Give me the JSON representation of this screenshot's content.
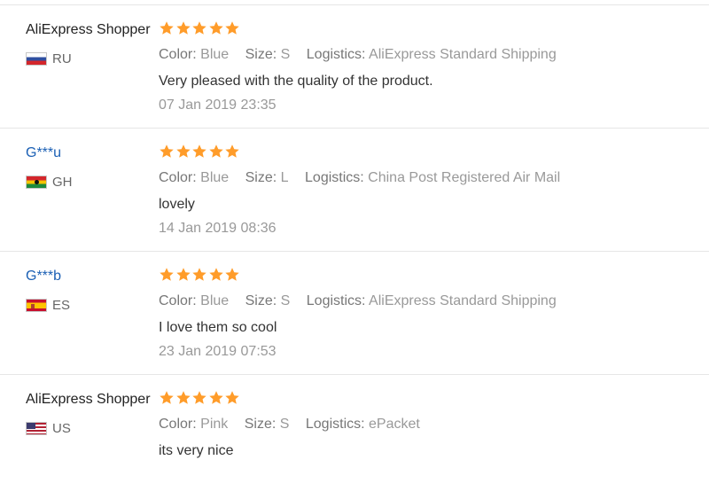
{
  "reviews": [
    {
      "user": "AliExpress Shopper",
      "country": "RU",
      "rating": 5,
      "attributes": [
        {
          "key": "Color:",
          "value": "Blue"
        },
        {
          "key": "Size:",
          "value": "S"
        },
        {
          "key": "Logistics:",
          "value": "AliExpress Standard Shipping"
        }
      ],
      "text": "Very pleased with the quality of the product.",
      "date": "07 Jan 2019 23:35"
    },
    {
      "user": "G***u",
      "country": "GH",
      "rating": 5,
      "attributes": [
        {
          "key": "Color:",
          "value": "Blue"
        },
        {
          "key": "Size:",
          "value": "L"
        },
        {
          "key": "Logistics:",
          "value": "China Post Registered Air Mail"
        }
      ],
      "text": "lovely",
      "date": "14 Jan 2019 08:36"
    },
    {
      "user": "G***b",
      "country": "ES",
      "rating": 5,
      "attributes": [
        {
          "key": "Color:",
          "value": "Blue"
        },
        {
          "key": "Size:",
          "value": "S"
        },
        {
          "key": "Logistics:",
          "value": "AliExpress Standard Shipping"
        }
      ],
      "text": "I love them so cool",
      "date": "23 Jan 2019 07:53"
    },
    {
      "user": "AliExpress Shopper",
      "country": "US",
      "rating": 5,
      "attributes": [
        {
          "key": "Color:",
          "value": "Pink"
        },
        {
          "key": "Size:",
          "value": "S"
        },
        {
          "key": "Logistics:",
          "value": "ePacket"
        }
      ],
      "text": "its very nice",
      "date": ""
    }
  ],
  "colors": {
    "star": "#ff9c2a",
    "link": "#1a5fb4"
  }
}
